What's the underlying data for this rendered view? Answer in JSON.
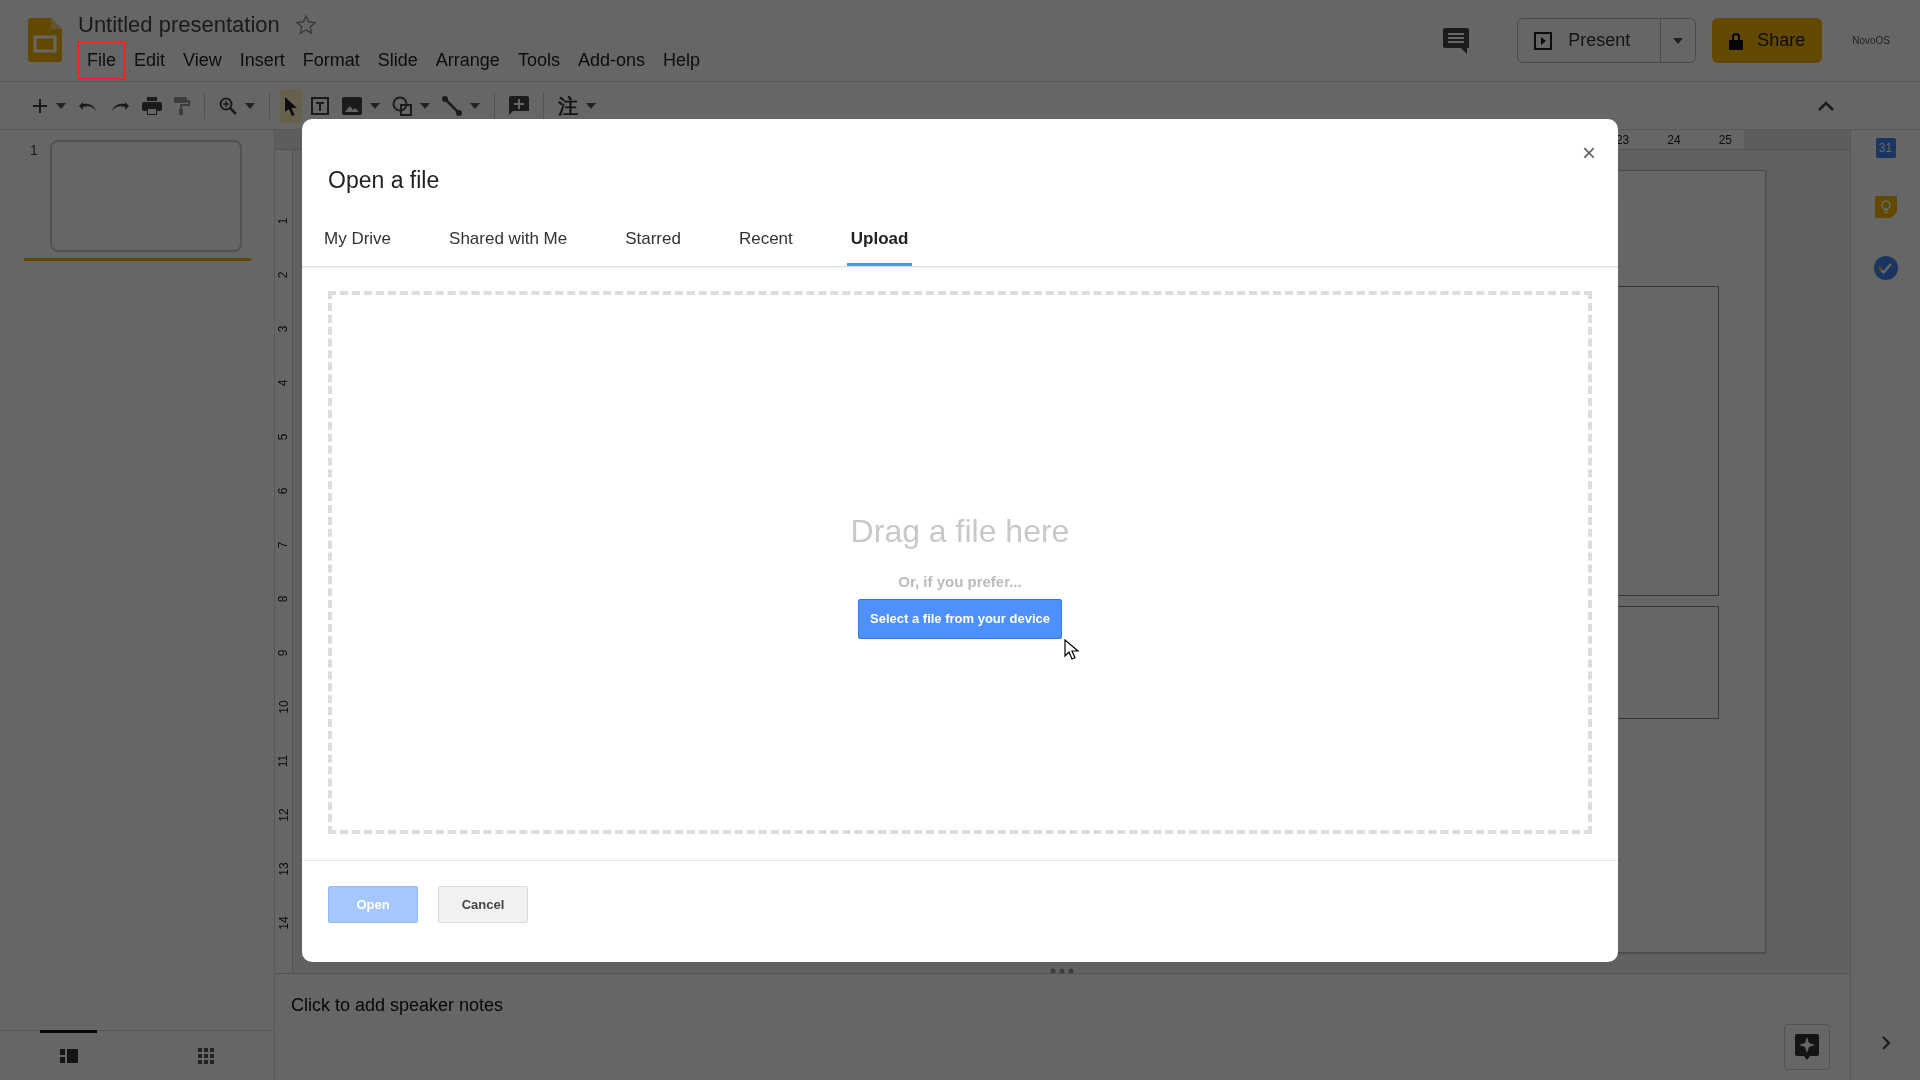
{
  "document": {
    "title": "Untitled presentation",
    "starred": false
  },
  "menu": [
    {
      "label": "File",
      "highlighted": true
    },
    {
      "label": "Edit",
      "highlighted": false
    },
    {
      "label": "View",
      "highlighted": false
    },
    {
      "label": "Insert",
      "highlighted": false
    },
    {
      "label": "Format",
      "highlighted": false
    },
    {
      "label": "Slide",
      "highlighted": false
    },
    {
      "label": "Arrange",
      "highlighted": false
    },
    {
      "label": "Tools",
      "highlighted": false
    },
    {
      "label": "Add-ons",
      "highlighted": false
    },
    {
      "label": "Help",
      "highlighted": false
    }
  ],
  "toolbar": [
    {
      "kind": "new-slide",
      "caret": true,
      "selected": false
    },
    {
      "kind": "undo",
      "caret": false,
      "selected": false
    },
    {
      "kind": "redo",
      "caret": false,
      "selected": false
    },
    {
      "kind": "print",
      "caret": false,
      "selected": false
    },
    {
      "kind": "paint-format",
      "caret": false,
      "selected": false
    },
    {
      "kind": "zoom",
      "caret": true,
      "selected": false
    },
    {
      "kind": "select",
      "caret": false,
      "selected": true
    },
    {
      "kind": "text-box",
      "caret": false,
      "selected": false
    },
    {
      "kind": "image",
      "caret": true,
      "selected": false
    },
    {
      "kind": "shape",
      "caret": true,
      "selected": false
    },
    {
      "kind": "line",
      "caret": true,
      "selected": false
    },
    {
      "kind": "comment",
      "caret": false,
      "selected": false
    },
    {
      "kind": "input-tools",
      "glyph": "注",
      "caret": true,
      "selected": false
    }
  ],
  "header_actions": {
    "present": "Present",
    "share": "Share",
    "account_logo": "NovoOS"
  },
  "filmstrip": {
    "slides": [
      {
        "number": "1",
        "selected": true
      }
    ],
    "views": [
      {
        "kind": "list",
        "selected": true
      },
      {
        "kind": "grid",
        "selected": false
      }
    ]
  },
  "rulers": {
    "horizontal": [
      "23",
      "24",
      "25"
    ],
    "vertical": [
      "1",
      "2",
      "3",
      "4",
      "5",
      "6",
      "7",
      "8",
      "9",
      "10",
      "11",
      "12",
      "13",
      "14"
    ]
  },
  "notes": {
    "prompt": "Click to add speaker notes"
  },
  "side_panel": {
    "calendar_day": "31"
  },
  "dialog": {
    "title": "Open a file",
    "close": "×",
    "tabs": [
      {
        "label": "My Drive",
        "selected": false
      },
      {
        "label": "Shared with Me",
        "selected": false
      },
      {
        "label": "Starred",
        "selected": false
      },
      {
        "label": "Recent",
        "selected": false
      },
      {
        "label": "Upload",
        "selected": true
      }
    ],
    "drop_zone": {
      "heading": "Drag a file here",
      "hint": "Or, if you prefer...",
      "button": "Select a file from your device"
    },
    "buttons": [
      {
        "label": "Open",
        "kind": "primary",
        "disabled": true
      },
      {
        "label": "Cancel",
        "kind": "secondary",
        "disabled": false
      }
    ]
  }
}
